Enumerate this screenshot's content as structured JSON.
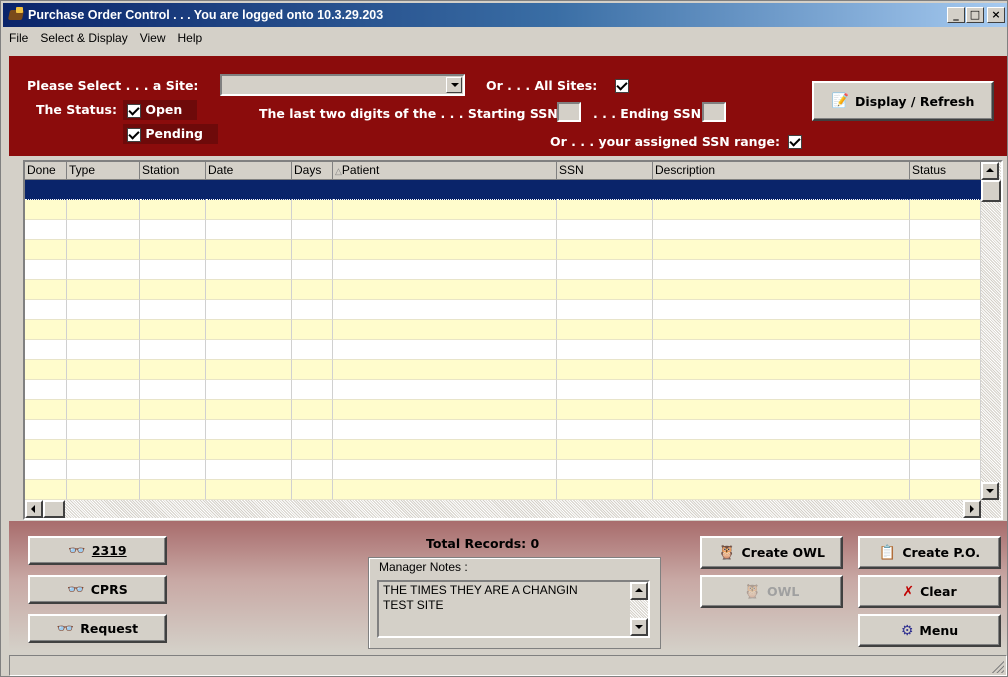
{
  "window": {
    "title": "Purchase Order Control . . . You are logged onto 10.3.29.203",
    "minimize": "_",
    "maximize": "□",
    "close": "×"
  },
  "menu": [
    "File",
    "Select & Display",
    "View",
    "Help"
  ],
  "filters": {
    "site_label": "Please Select . . . a Site:",
    "site_value": "",
    "all_sites_label": "Or . . . All Sites:",
    "all_sites_checked": true,
    "status_label": "The Status:",
    "open_label": "Open",
    "open_checked": true,
    "pending_label": "Pending",
    "pending_checked": true,
    "starting_ssn_label": "The last two digits of the . . . Starting SSN:",
    "ending_ssn_label": ". . . Ending SSN:",
    "assigned_range_label": "Or . . . your assigned SSN range:",
    "assigned_range_checked": true
  },
  "buttons": {
    "display_refresh": "Display / Refresh",
    "btn_2319": "2319",
    "cprs": "CPRS",
    "request": "Request",
    "create_owl": "Create OWL",
    "owl": "OWL",
    "create_po": "Create P.O.",
    "clear": "Clear",
    "menu": "Menu"
  },
  "grid": {
    "columns": [
      "Done",
      "Type",
      "Station",
      "Date",
      "Days",
      "Patient",
      "SSN",
      "Description",
      "Status"
    ],
    "sort_column": "Patient",
    "rows": 17
  },
  "total_records": "Total Records: 0",
  "manager_notes": {
    "label": "Manager Notes :",
    "text_line1": "THE TIMES THEY ARE A  CHANGIN",
    "text_line2": "TEST SITE"
  },
  "colors": {
    "panel_red": "#8b0c0c",
    "row_alt": "#fffccc",
    "selection": "#0a246a"
  }
}
